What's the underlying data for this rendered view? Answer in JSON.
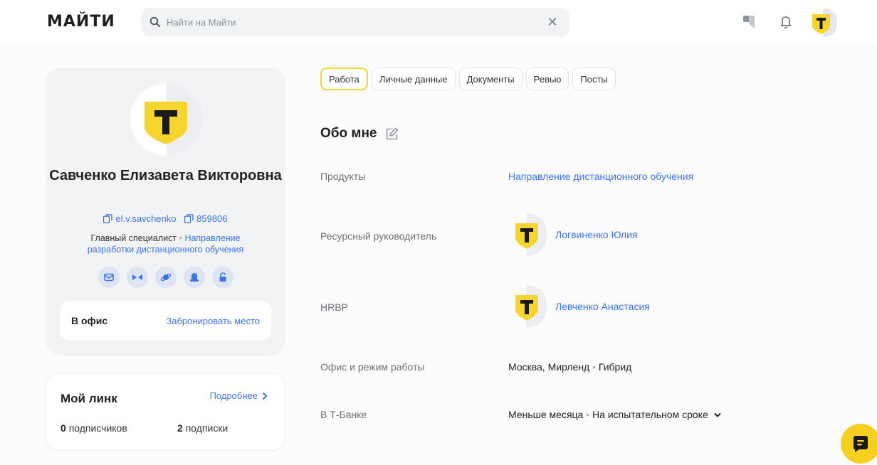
{
  "header": {
    "logo": "МАЙТИ",
    "search_placeholder": "Найти на Майти"
  },
  "profile": {
    "name": "Савченко Елизавета Викторовна",
    "login": "el.v.savchenko",
    "tab_number": "859806",
    "position": "Главный специалист",
    "department": "Направление разработки дистанционного обучения",
    "office_label": "В офис",
    "office_link": "Забронировать место"
  },
  "my_link": {
    "title": "Мой линк",
    "more": "Подробнее",
    "followers_count": "0",
    "followers_label": "подписчиков",
    "following_count": "2",
    "following_label": "подписки"
  },
  "tabs": [
    {
      "label": "Работа",
      "active": true
    },
    {
      "label": "Личные данные",
      "active": false
    },
    {
      "label": "Документы",
      "active": false
    },
    {
      "label": "Ревью",
      "active": false
    },
    {
      "label": "Посты",
      "active": false
    }
  ],
  "about": {
    "title": "Обо мне",
    "rows": {
      "products": {
        "label": "Продукты",
        "value": "Направление дистанционного обучения"
      },
      "manager": {
        "label": "Ресурсный руководитель",
        "value": "Логвиненко Юлия"
      },
      "hrbp": {
        "label": "HRBP",
        "value": "Левченко Анастасия"
      },
      "office": {
        "label": "Офис и режим работы",
        "city": "Москва, Мирленд",
        "mode": "Гибрид"
      },
      "tenure": {
        "label": "В Т-Банке",
        "duration": "Меньше месяца",
        "status": "На испытательном сроке"
      }
    }
  },
  "colors": {
    "accent": "#3b74e6",
    "brand_yellow": "#f7cf1e",
    "card_bg": "#f2f3f5"
  }
}
